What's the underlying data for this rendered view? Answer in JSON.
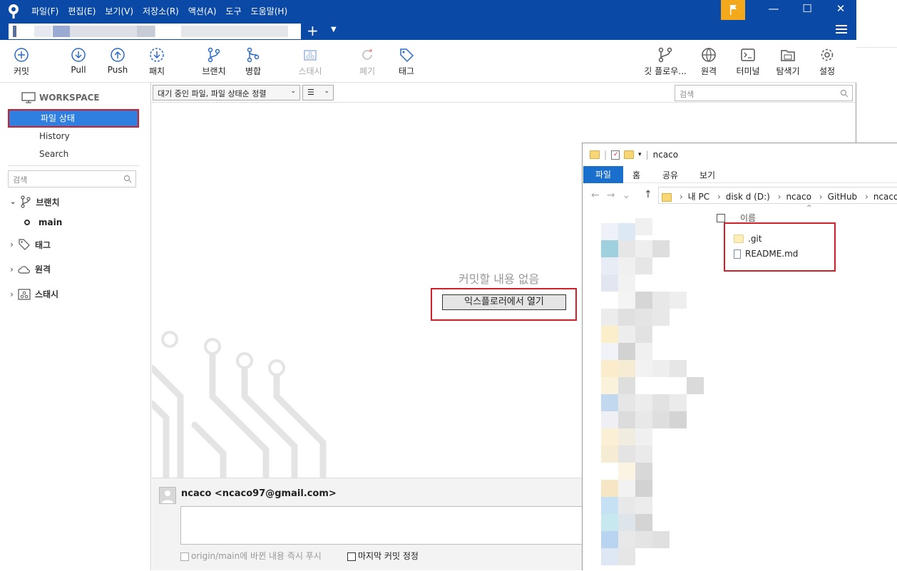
{
  "menu": [
    "파일(F)",
    "편집(E)",
    "보기(V)",
    "저장소(R)",
    "액션(A)",
    "도구",
    "도움말(H)"
  ],
  "toolbar": {
    "commit": "커밋",
    "pull": "Pull",
    "push": "Push",
    "patch": "패치",
    "branch": "브랜치",
    "merge": "병합",
    "stash": "스태시",
    "discard": "폐기",
    "tag": "태그",
    "gitflow": "깃 플로우...",
    "remote": "원격",
    "terminal": "터미널",
    "explorer": "탐색기",
    "settings": "설정"
  },
  "sidebar": {
    "workspace": "WORKSPACE",
    "file_status": "파일 상태",
    "history": "History",
    "search": "Search",
    "search_placeholder": "검색",
    "branches": "브랜치",
    "current_branch": "main",
    "tags": "태그",
    "remotes": "원격",
    "stashes": "스태시"
  },
  "main": {
    "filter_select": "대기 중인 파일, 파일 상태순 정렬",
    "search_placeholder": "검색",
    "empty_message": "커밋할 내용 없음",
    "open_explorer": "익스플로러에서 열기"
  },
  "commit": {
    "author": "ncaco <ncaco97@gmail.com>",
    "push_option": "origin/main에 바뀐 내용 즉시 푸시",
    "amend_option": "마지막 커밋 정정"
  },
  "explorer": {
    "title": "ncaco",
    "ribbon": [
      "파일",
      "홈",
      "공유",
      "보기"
    ],
    "path": [
      "내 PC",
      "disk d (D:)",
      "ncaco",
      "GitHub",
      "ncaco"
    ],
    "column_name": "이름",
    "files": [
      ".git",
      "README.md"
    ]
  },
  "colors": {
    "titlebar": "#0a4aa6",
    "accent": "#2f7fe0",
    "highlight": "#d0202a"
  }
}
